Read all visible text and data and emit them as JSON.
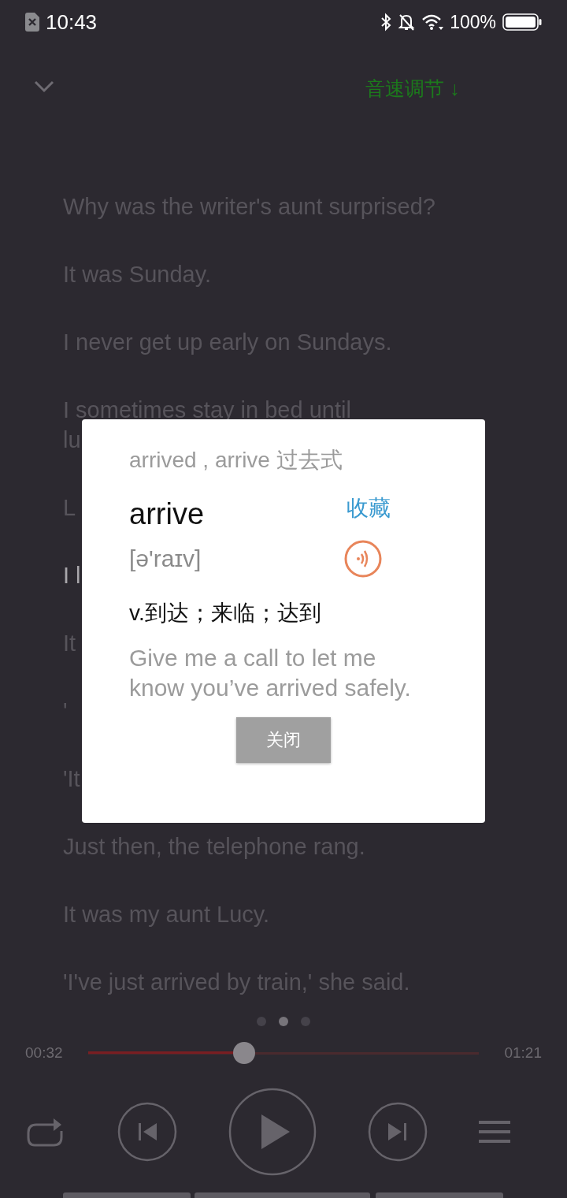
{
  "status_bar": {
    "time": "10:43",
    "battery": "100%"
  },
  "header": {
    "speed_button": "音速调节 ↓"
  },
  "transcript": [
    {
      "text": "Why was the writer's aunt surprised?",
      "current": false
    },
    {
      "text": "It was Sunday.",
      "current": false
    },
    {
      "text": "I never get up early on Sundays.",
      "current": false
    },
    {
      "text": "I sometimes stay in bed until",
      "current": false
    },
    {
      "text": "lu",
      "current": false
    },
    {
      "text": "L",
      "current": false
    },
    {
      "text": "I l",
      "current": true
    },
    {
      "text": "It",
      "current": false
    },
    {
      "text": "'",
      "current": false
    },
    {
      "text": "'It",
      "current": false
    },
    {
      "text": "Just then, the telephone rang.",
      "current": false
    },
    {
      "text": "It was my aunt Lucy.",
      "current": false
    },
    {
      "text": "'I've just arrived by train,' she said.",
      "current": false
    }
  ],
  "word_dialog": {
    "form_note": "arrived , arrive 过去式",
    "word": "arrive",
    "favorite_button": "收藏",
    "phonetic": "[ə'raɪv]",
    "definition": "v.到达；来临；达到",
    "example": "Give me a call to let me know you’ve arrived safely.",
    "close_button": "关闭"
  },
  "pager": [
    {
      "selected": false
    },
    {
      "selected": true
    },
    {
      "selected": false
    }
  ],
  "player": {
    "elapsed": "00:32",
    "duration": "01:21",
    "level": 0.4
  }
}
